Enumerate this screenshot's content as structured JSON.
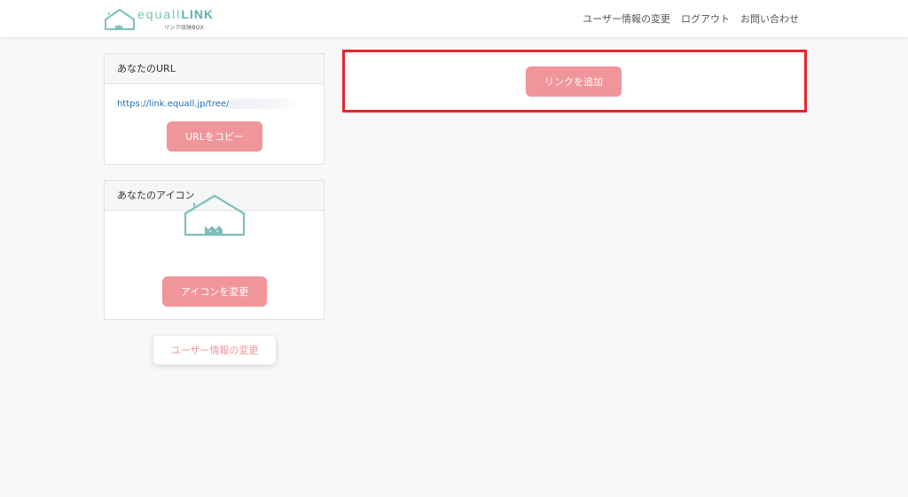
{
  "header": {
    "logo": {
      "name_light": "equall",
      "name_strong": "LINK",
      "subtitle": "リンク収納BOX"
    },
    "nav": [
      {
        "label": "ユーザー情報の変更"
      },
      {
        "label": "ログアウト"
      },
      {
        "label": "お問い合わせ"
      }
    ]
  },
  "url_card": {
    "title": "あなたのURL",
    "url_prefix": "https://link.equall.jp/tree/",
    "copy_button": "URLをコピー"
  },
  "icon_card": {
    "title": "あなたのアイコン",
    "icon": "house-cat-icon",
    "change_button": "アイコンを変更"
  },
  "user_button": "ユーザー情報の変更",
  "main": {
    "add_link_button": "リンクを追加"
  },
  "colors": {
    "accent_pink": "#f0959a",
    "teal": "#7cc0bd",
    "highlight_border": "#e8262b",
    "link_blue": "#1e6fb8"
  }
}
